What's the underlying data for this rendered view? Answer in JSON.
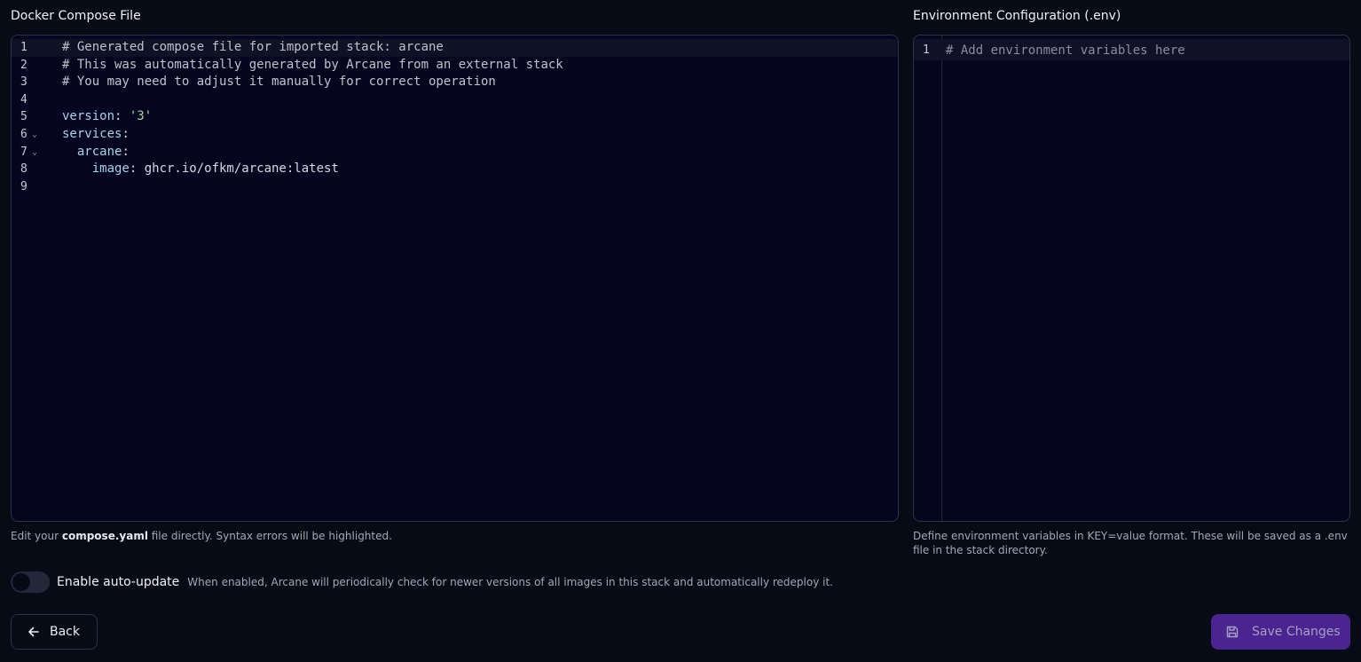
{
  "compose": {
    "title": "Docker Compose File",
    "lines": [
      {
        "num": "1",
        "fold": "",
        "tokens": [
          {
            "t": "# Generated compose file for imported stack: arcane",
            "c": "tok-comment"
          }
        ]
      },
      {
        "num": "2",
        "fold": "",
        "tokens": [
          {
            "t": "# This was automatically generated by Arcane from an external stack",
            "c": "tok-comment"
          }
        ]
      },
      {
        "num": "3",
        "fold": "",
        "tokens": [
          {
            "t": "# You may need to adjust it manually for correct operation",
            "c": "tok-comment"
          }
        ]
      },
      {
        "num": "4",
        "fold": "",
        "tokens": []
      },
      {
        "num": "5",
        "fold": "",
        "tokens": [
          {
            "t": "version",
            "c": "tok-key"
          },
          {
            "t": ": ",
            "c": "tok-plain"
          },
          {
            "t": "'3'",
            "c": "tok-string"
          }
        ]
      },
      {
        "num": "6",
        "fold": "⌄",
        "tokens": [
          {
            "t": "services",
            "c": "tok-key"
          },
          {
            "t": ":",
            "c": "tok-plain"
          }
        ]
      },
      {
        "num": "7",
        "fold": "⌄",
        "tokens": [
          {
            "t": "  arcane",
            "c": "tok-key"
          },
          {
            "t": ":",
            "c": "tok-plain"
          }
        ]
      },
      {
        "num": "8",
        "fold": "",
        "tokens": [
          {
            "t": "    image",
            "c": "tok-key"
          },
          {
            "t": ": ghcr.io/ofkm/arcane:latest",
            "c": "tok-plain"
          }
        ]
      },
      {
        "num": "9",
        "fold": "",
        "tokens": []
      }
    ],
    "help_prefix": "Edit your ",
    "help_file": "compose.yaml",
    "help_suffix": " file directly. Syntax errors will be highlighted."
  },
  "env": {
    "title": "Environment Configuration (.env)",
    "line_num": "1",
    "placeholder": "# Add environment variables here",
    "help": "Define environment variables in KEY=value format. These will be saved as a .env file in the stack directory."
  },
  "auto_update": {
    "label": "Enable auto-update",
    "description": "When enabled, Arcane will periodically check for newer versions of all images in this stack and automatically redeploy it.",
    "enabled": false
  },
  "actions": {
    "back_label": "Back",
    "save_label": "Save Changes"
  },
  "colors": {
    "background": "#070b16",
    "editor_bg": "#05051f",
    "save_button_bg": "#4a2590"
  },
  "icons": {
    "back": "arrow-left-icon",
    "save": "floppy-disk-icon",
    "fold": "chevron-down-icon"
  }
}
